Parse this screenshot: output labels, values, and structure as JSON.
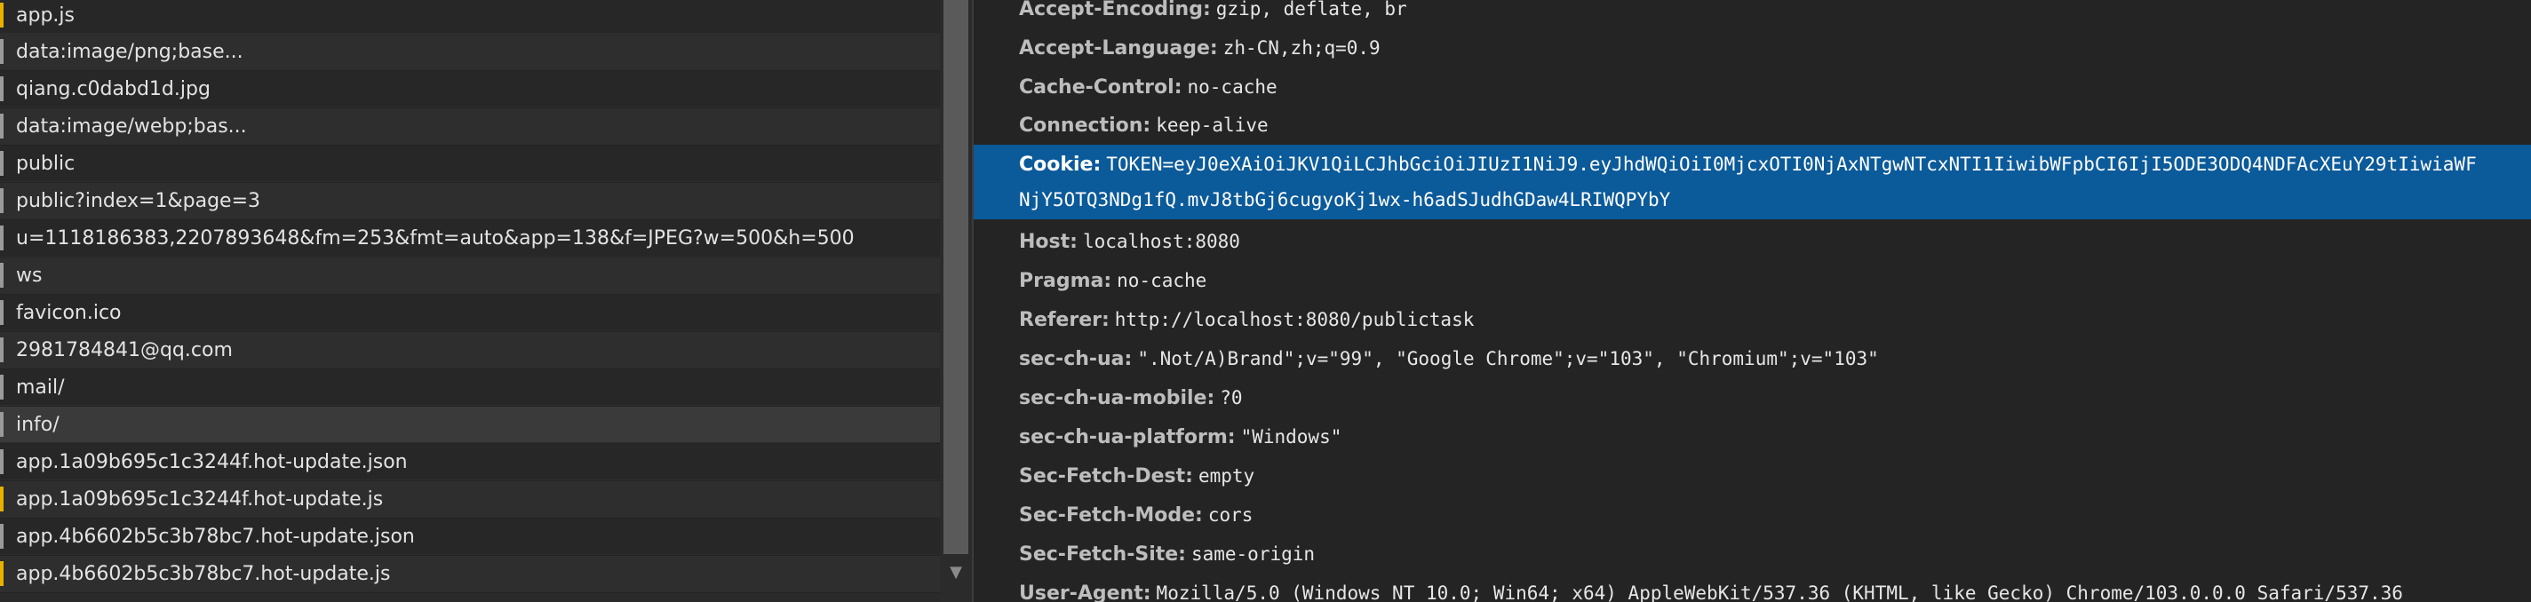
{
  "requests": [
    {
      "name": "app.js",
      "icon": "script-file-icon"
    },
    {
      "name": "data:image/png;base...",
      "icon": "file-icon"
    },
    {
      "name": "qiang.c0dabd1d.jpg",
      "icon": "file-icon"
    },
    {
      "name": "data:image/webp;bas...",
      "icon": "file-icon"
    },
    {
      "name": "public",
      "icon": "file-icon"
    },
    {
      "name": "public?index=1&page=3",
      "icon": "file-icon"
    },
    {
      "name": "u=1118186383,2207893648&fm=253&fmt=auto&app=138&f=JPEG?w=500&h=500",
      "icon": "file-icon"
    },
    {
      "name": "ws",
      "icon": "file-icon"
    },
    {
      "name": "favicon.ico",
      "icon": "file-icon"
    },
    {
      "name": "2981784841@qq.com",
      "icon": "file-icon"
    },
    {
      "name": "mail/",
      "icon": "file-icon"
    },
    {
      "name": "info/",
      "icon": "file-icon",
      "selected": true
    },
    {
      "name": "app.1a09b695c1c3244f.hot-update.json",
      "icon": "file-icon"
    },
    {
      "name": "app.1a09b695c1c3244f.hot-update.js",
      "icon": "script-file-icon"
    },
    {
      "name": "app.4b6602b5c3b78bc7.hot-update.json",
      "icon": "file-icon"
    },
    {
      "name": "app.4b6602b5c3b78bc7.hot-update.js",
      "icon": "script-file-icon"
    }
  ],
  "headers_before_cookie": [
    {
      "key": "Accept-Encoding:",
      "value": "gzip, deflate, br"
    },
    {
      "key": "Accept-Language:",
      "value": "zh-CN,zh;q=0.9"
    },
    {
      "key": "Cache-Control:",
      "value": "no-cache"
    },
    {
      "key": "Connection:",
      "value": "keep-alive"
    }
  ],
  "cookie": {
    "key": "Cookie:",
    "value_line1": "TOKEN=eyJ0eXAiOiJKV1QiLCJhbGciOiJIUzI1NiJ9.eyJhdWQiOiI0MjcxOTI0NjAxNTgwNTcxNTI1IiwibWFpbCI6IjI5ODE3ODQ4NDFAcXEuY29tIiwiaWF",
    "value_line2": "NjY5OTQ3NDg1fQ.mvJ8tbGj6cugyoKj1wx-h6adSJudhGDaw4LRIWQPYbY"
  },
  "headers_after_cookie": [
    {
      "key": "Host:",
      "value": "localhost:8080"
    },
    {
      "key": "Pragma:",
      "value": "no-cache"
    },
    {
      "key": "Referer:",
      "value": "http://localhost:8080/publictask"
    },
    {
      "key": "sec-ch-ua:",
      "value": "\".Not/A)Brand\";v=\"99\", \"Google Chrome\";v=\"103\", \"Chromium\";v=\"103\""
    },
    {
      "key": "sec-ch-ua-mobile:",
      "value": "?0"
    },
    {
      "key": "sec-ch-ua-platform:",
      "value": "\"Windows\""
    },
    {
      "key": "Sec-Fetch-Dest:",
      "value": "empty"
    },
    {
      "key": "Sec-Fetch-Mode:",
      "value": "cors"
    },
    {
      "key": "Sec-Fetch-Site:",
      "value": "same-origin"
    },
    {
      "key": "User-Agent:",
      "value": "Mozilla/5.0 (Windows NT 10.0; Win64; x64) AppleWebKit/537.36 (KHTML, like Gecko) Chrome/103.0.0.0 Safari/537.36"
    }
  ],
  "colors": {
    "background": "#242424",
    "selected_header_row": "#0b5a9a",
    "script_icon": "#e8b100"
  }
}
